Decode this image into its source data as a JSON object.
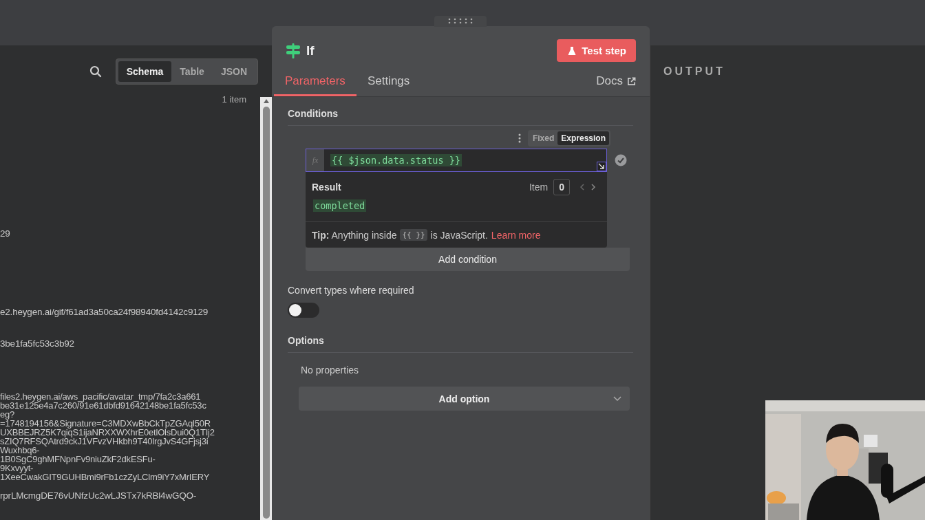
{
  "input_panel": {
    "view_tabs": [
      {
        "label": "Schema",
        "selected": true
      },
      {
        "label": "Table",
        "selected": false
      },
      {
        "label": "JSON",
        "selected": false
      }
    ],
    "item_count": "1 item",
    "values": [
      {
        "lines": [
          "29"
        ]
      },
      {
        "lines": [
          "e2.heygen.ai/gif/f61ad3a50ca24f98940fd4142c9129"
        ]
      },
      {
        "lines": [
          "3be1fa5fc53c3b92"
        ]
      },
      {
        "lines": [
          "files2.heygen.ai/aws_pacific/avatar_tmp/7fa2c3a661",
          "be31e125e4a7c260/91e61dbfd91642148be1fa5fc53c",
          "eg?",
          "=1748194156&Signature=C3MDXwBbCkTpZGAql50R",
          "UXBBEJRZ5K7qiqS1ijaNRXXWXhrE0etlOlsDui0Q1TIj2",
          "sZIQ7RFSQAtrd9ckJ1VFvzVHkbh9T40lrgJvS4GFjsj3i",
          "Wuxhbq6-",
          "1B0SgC9ghMFNpnFv9niuZkF2dkESFu-",
          "9Kxvyyt-",
          "1XeeCwakGIT9GUHBmi9rFb1czZyLClm9iY7xMrIERY"
        ]
      },
      {
        "lines": [
          "rprLMcmgDE76vUNfzUc2wLJSTx7kRBl4wGQO-"
        ]
      }
    ]
  },
  "node": {
    "title": "If",
    "test_button": "Test step",
    "tabs": [
      {
        "label": "Parameters",
        "selected": true
      },
      {
        "label": "Settings",
        "selected": false
      }
    ],
    "docs_link": "Docs",
    "conditions": {
      "heading": "Conditions",
      "mode_options": [
        {
          "label": "Fixed",
          "selected": false
        },
        {
          "label": "Expression",
          "selected": true
        }
      ],
      "fx_label": "fx",
      "expression": "{{ $json.data.status }}",
      "valid": true,
      "result": {
        "heading": "Result",
        "item_label": "Item",
        "item_index": "0",
        "value": "completed",
        "tip_text": "**Tip:** Anything inside",
        "tip_code": "{{ }}",
        "tip_text_2": "is JavaScript.",
        "tip_link": "Learn more"
      },
      "add_button": "Add condition"
    },
    "convert_types": {
      "label": "Convert types where required",
      "on": false
    },
    "options": {
      "heading": "Options",
      "empty_text": "No properties",
      "add_button": "Add option"
    }
  },
  "output_panel": {
    "heading": "OUTPUT"
  }
}
